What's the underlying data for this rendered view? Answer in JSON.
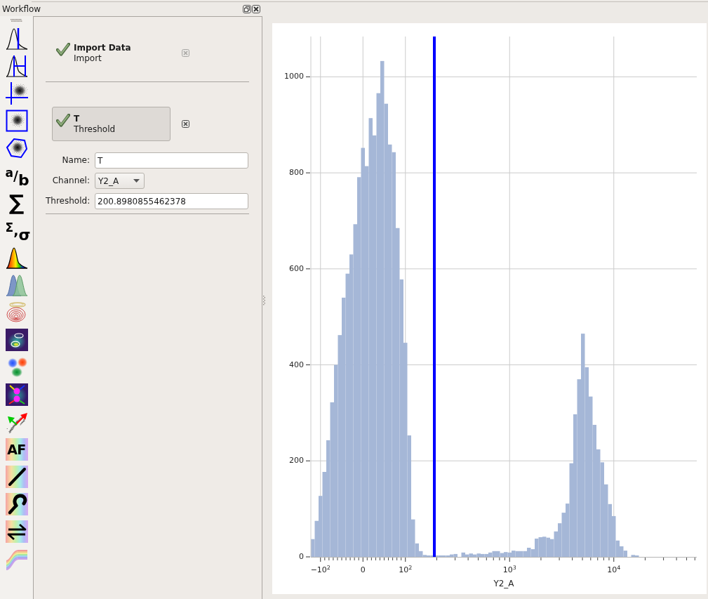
{
  "dock": {
    "title": "Workflow"
  },
  "toolbar": {
    "tools": [
      {
        "kind": "icon"
      },
      {
        "kind": "icon"
      },
      {
        "kind": "icon"
      },
      {
        "kind": "icon"
      },
      {
        "kind": "icon"
      },
      {
        "kind": "glyph",
        "text": "$^{a}$/$_{b}$"
      },
      {
        "kind": "glyph",
        "text": "∑"
      },
      {
        "kind": "glyph",
        "text": "$^{Σ}$,$_{σ}$"
      },
      {
        "kind": "icon"
      },
      {
        "kind": "icon"
      },
      {
        "kind": "icon"
      },
      {
        "kind": "icon"
      },
      {
        "kind": "icon"
      },
      {
        "kind": "icon"
      },
      {
        "kind": "icon"
      },
      {
        "kind": "tile-glyph",
        "text": "AF"
      },
      {
        "kind": "icon"
      },
      {
        "kind": "icon"
      },
      {
        "kind": "icon"
      },
      {
        "kind": "icon"
      }
    ]
  },
  "workflow": {
    "items": [
      {
        "title": "Import Data",
        "subtitle": "Import",
        "done": true,
        "selected": false,
        "remove_disabled": true
      },
      {
        "title": "T",
        "subtitle": "Threshold",
        "done": true,
        "selected": true,
        "remove_disabled": false
      }
    ],
    "settings": [
      {
        "kind": "text",
        "label": "Name:",
        "value": "T"
      },
      {
        "kind": "dropdown",
        "label": "Channel:",
        "value": "Y2_A"
      },
      {
        "kind": "text",
        "label": "Threshold:",
        "value": "200.8980855462378"
      }
    ]
  },
  "plot": {
    "chart_data": {
      "type": "bar",
      "xlabel": "Y2_A",
      "grid": true,
      "categories": [
        null,
        null,
        "−10$^{2}$",
        null,
        null,
        null,
        null,
        null,
        null,
        null,
        null,
        null,
        null,
        "0",
        null,
        null,
        null,
        null,
        null,
        null,
        null,
        null,
        null,
        null,
        "10$^{2}$",
        null,
        null,
        null,
        null,
        null,
        null,
        null,
        null,
        null,
        null,
        null,
        null,
        null,
        null,
        null,
        null,
        null,
        null,
        null,
        null,
        null,
        null,
        null,
        null,
        null,
        null,
        "10$^{3}$",
        null,
        null,
        null,
        null,
        null,
        null,
        null,
        null,
        null,
        null,
        null,
        null,
        null,
        null,
        null,
        null,
        null,
        null,
        null,
        null,
        null,
        null,
        null,
        null,
        null,
        null,
        "10$^{4}$",
        null,
        null,
        null,
        null,
        null,
        null,
        null,
        null,
        null,
        null,
        null,
        null,
        null,
        null,
        null,
        null,
        null,
        null,
        null,
        null,
        null
      ],
      "series": [
        {
          "color": "#a5b7d7",
          "values": [
            37,
            75,
            127,
            177,
            243,
            322,
            400,
            462,
            540,
            590,
            630,
            693,
            791,
            852,
            814,
            914,
            878,
            966,
            1033,
            944,
            859,
            843,
            685,
            578,
            446,
            253,
            78,
            28,
            12,
            4,
            3,
            3,
            3,
            3,
            3,
            3,
            5,
            6,
            0,
            9,
            5,
            7,
            5,
            7,
            6,
            6,
            9,
            12,
            12,
            8,
            10,
            9,
            13,
            12,
            12,
            12,
            19,
            16,
            38,
            41,
            42,
            40,
            37,
            53,
            70,
            92,
            111,
            195,
            297,
            370,
            465,
            395,
            334,
            275,
            224,
            197,
            151,
            110,
            85,
            34,
            22,
            13,
            0,
            4,
            3,
            null,
            null,
            null,
            null,
            null,
            null,
            null,
            null,
            null,
            null,
            null,
            null,
            null,
            null,
            null
          ]
        }
      ],
      "ylim": [
        0,
        1084
      ],
      "yticks": [
        0,
        200,
        400,
        600,
        800,
        1000
      ]
    }
  }
}
